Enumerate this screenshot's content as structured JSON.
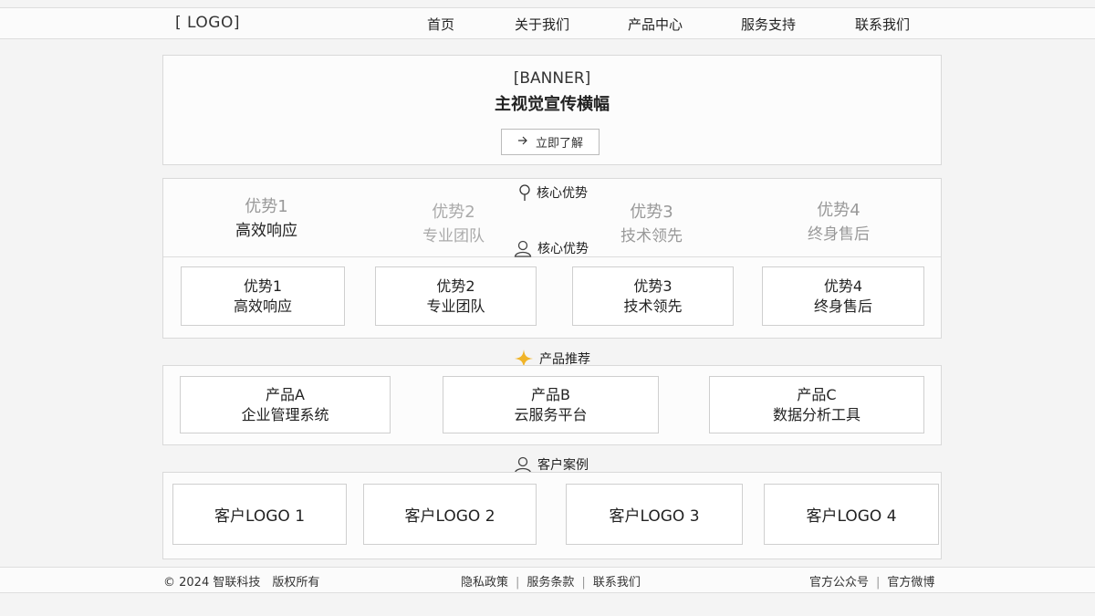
{
  "header": {
    "logo": "[ LOGO]",
    "nav": [
      "首页",
      "关于我们",
      "产品中心",
      "服务支持",
      "联系我们"
    ]
  },
  "banner": {
    "tag": "[BANNER]",
    "title": "主视觉宣传横幅",
    "cta_icon": "arrow-right-icon",
    "cta": "立即了解"
  },
  "advantages": {
    "title_top": "核心优势",
    "title_top_icon": "map-pin-icon",
    "faded": [
      {
        "name": "优势1",
        "desc": "高效响应"
      },
      {
        "name": "优势2",
        "desc": "专业团队"
      },
      {
        "name": "优势3",
        "desc": "技术领先"
      },
      {
        "name": "优势4",
        "desc": "终身售后"
      }
    ],
    "title": "核心优势",
    "title_icon": "user-icon",
    "items": [
      {
        "name": "优势1",
        "desc": "高效响应"
      },
      {
        "name": "优势2",
        "desc": "专业团队"
      },
      {
        "name": "优势3",
        "desc": "技术领先"
      },
      {
        "name": "优势4",
        "desc": "终身售后"
      }
    ]
  },
  "products": {
    "title": "产品推荐",
    "title_icon": "sparkle-icon",
    "accent": "#f0b429",
    "items": [
      {
        "name": "产品A",
        "desc": "企业管理系统"
      },
      {
        "name": "产品B",
        "desc": "云服务平台"
      },
      {
        "name": "产品C",
        "desc": "数据分析工具"
      }
    ]
  },
  "cases": {
    "title": "客户案例",
    "title_icon": "user-icon",
    "items": [
      "客户LOGO 1",
      "客户LOGO 2",
      "客户LOGO 3",
      "客户LOGO 4"
    ]
  },
  "footer": {
    "copyright": "© 2024 智联科技　版权所有",
    "links": [
      "隐私政策",
      "服务条款",
      "联系我们"
    ],
    "social": [
      "官方公众号",
      "官方微博"
    ],
    "separator": "|"
  }
}
